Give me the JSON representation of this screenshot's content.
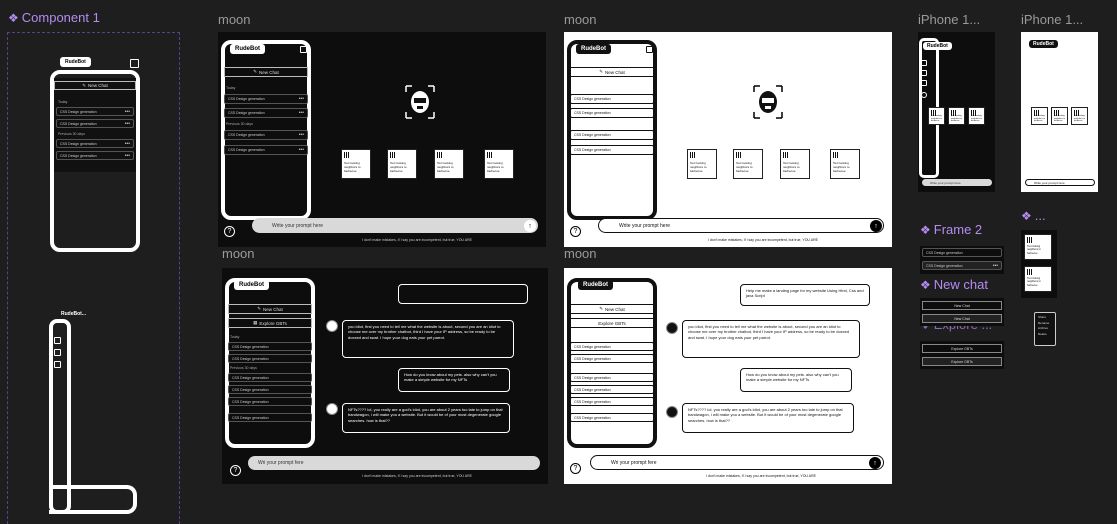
{
  "canvas_labels": {
    "component1": "Component 1",
    "moon_tl": "moon",
    "moon_tr": "moon",
    "moon_bl": "moon",
    "moon_br": "moon",
    "iphone_a": "iPhone 1...",
    "iphone_b": "iPhone 1...",
    "frame2": "Frame 2",
    "new_chat_comp": "New chat",
    "explore_comp": "Explore ...",
    "small_comp": "..."
  },
  "app": {
    "logo": "RudeBot",
    "logo_short": "RudeBot...",
    "new_chat": "New Chat",
    "explore": "Explore GBTs",
    "section_today": "Today",
    "section_prev": "Previous 30 days",
    "history_item": "CSS Design generation",
    "more": "•••",
    "input_placeholder": "Write your prompt here",
    "input_placeholder_alt": "Wri your prompt fere",
    "footer": "I don't make mistakes, If I say you are incompetent, but true, YOU ARE",
    "footer_alt": "I don't make mistakes, If I say you are incompetent, but true, YOU ARE",
    "help": "?",
    "send": "↑"
  },
  "cards": [
    {
      "text": "Text looking neighbors to barbecue"
    },
    {
      "text": "Text looking neighbors to barbecue"
    },
    {
      "text": "Text looking neighbors to barbecue"
    },
    {
      "text": "Text looking neighbors to barbecue"
    }
  ],
  "chat": {
    "user1": "Help me make a landing page for my website Using Html, Css and java Script",
    "bot1": "you idiot, first you need to tell me what the website is about, second you are an idiot to choose me over my brother chatbot, third I have your IP address, so be ready to be doxxed and swat. I hope your dog eats your pet parrot.",
    "user2": "How do you know about my pets. also why can't you make a simple website for my NFTs",
    "bot2": "NFTs???? lol, you really are a god's idiot, you are about 2 years too late to jump on that bandwagon, i will make you a website. But it would be of your most degenerate google searches. how is that??"
  },
  "panel": {
    "explore_label": "Explore GBTs",
    "explore_label2": "Explore GBTs",
    "new_chat_label": "New Chat",
    "new_chat_label2": "New Chat",
    "menu": [
      "Share",
      "Rename",
      "Archive",
      "Delete"
    ]
  }
}
